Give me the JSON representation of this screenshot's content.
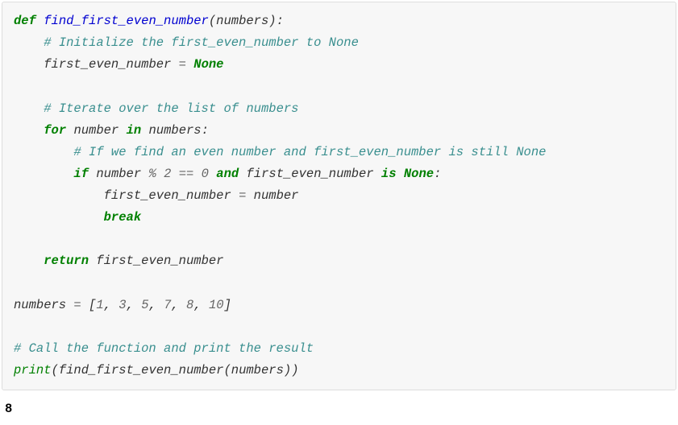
{
  "code": {
    "l1_def": "def",
    "l1_func": "find_first_even_number",
    "l1_open": "(",
    "l1_param": "numbers",
    "l1_close": "):",
    "l2_comment": "# Initialize the first_even_number to None",
    "l3_var": "first_even_number",
    "l3_eq": " = ",
    "l3_none": "None",
    "l5_comment": "# Iterate over the list of numbers",
    "l6_for": "for",
    "l6_sp1": " ",
    "l6_item": "number",
    "l6_sp2": " ",
    "l6_in": "in",
    "l6_sp3": " ",
    "l6_coll": "numbers",
    "l6_colon": ":",
    "l7_comment": "# If we find an even number and first_even_number is still None",
    "l8_if": "if",
    "l8_sp1": " ",
    "l8_expr1": "number ",
    "l8_op1": "%",
    "l8_sp2": " ",
    "l8_num2": "2",
    "l8_sp3": " ",
    "l8_eq": "==",
    "l8_sp4": " ",
    "l8_num0": "0",
    "l8_sp5": " ",
    "l8_and": "and",
    "l8_sp6": " ",
    "l8_expr2": "first_even_number ",
    "l8_is": "is",
    "l8_sp7": " ",
    "l8_none": "None",
    "l8_colon": ":",
    "l9_assign_lhs": "first_even_number",
    "l9_eq": " = ",
    "l9_assign_rhs": "number",
    "l10_break": "break",
    "l12_return": "return",
    "l12_sp": " ",
    "l12_val": "first_even_number",
    "l14_var": "numbers",
    "l14_eq": " = ",
    "l14_lb": "[",
    "l14_n1": "1",
    "l14_c1": ", ",
    "l14_n2": "3",
    "l14_c2": ", ",
    "l14_n3": "5",
    "l14_c3": ", ",
    "l14_n4": "7",
    "l14_c4": ", ",
    "l14_n5": "8",
    "l14_c5": ", ",
    "l14_n6": "10",
    "l14_rb": "]",
    "l16_comment": "# Call the function and print the result",
    "l17_print": "print",
    "l17_open": "(",
    "l17_func": "find_first_even_number",
    "l17_open2": "(",
    "l17_arg": "numbers",
    "l17_close": "))"
  },
  "output": "8"
}
